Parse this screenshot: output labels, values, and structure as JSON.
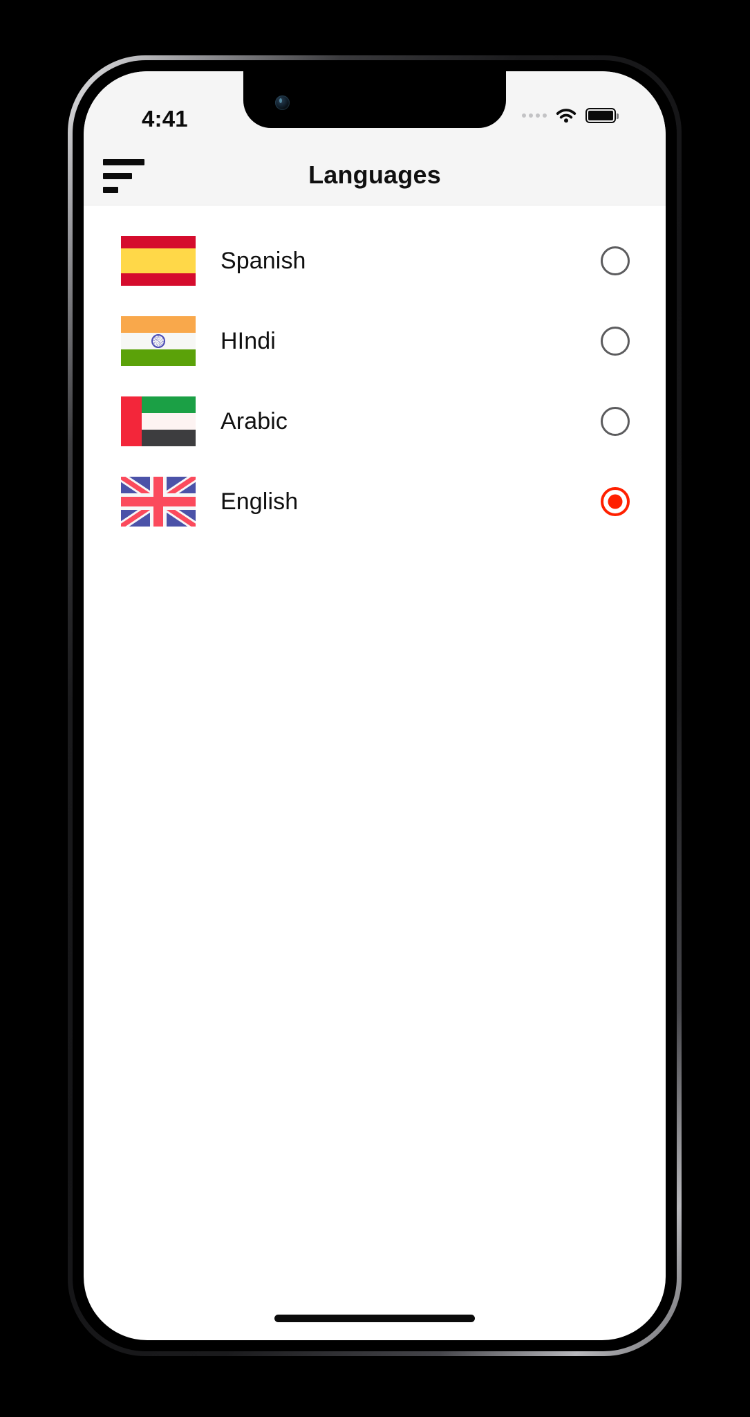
{
  "status_bar": {
    "time": "4:41",
    "cellular_icon": "signal-dots-icon",
    "wifi_icon": "wifi-icon",
    "battery_icon": "battery-full-icon"
  },
  "app_bar": {
    "menu_icon": "hamburger-menu-icon",
    "title": "Languages"
  },
  "colors": {
    "accent_selected": "#ff2000",
    "radio_unselected": "#5c5c5e",
    "app_bar_bg": "#f5f5f5",
    "screen_bg": "#ffffff"
  },
  "languages": [
    {
      "label": "Spanish",
      "flag": "flag-spain-icon",
      "selected": false
    },
    {
      "label": "HIndi",
      "flag": "flag-india-icon",
      "selected": false
    },
    {
      "label": "Arabic",
      "flag": "flag-uae-icon",
      "selected": false
    },
    {
      "label": "English",
      "flag": "flag-uk-icon",
      "selected": true
    }
  ],
  "home_indicator": "home-indicator-bar"
}
